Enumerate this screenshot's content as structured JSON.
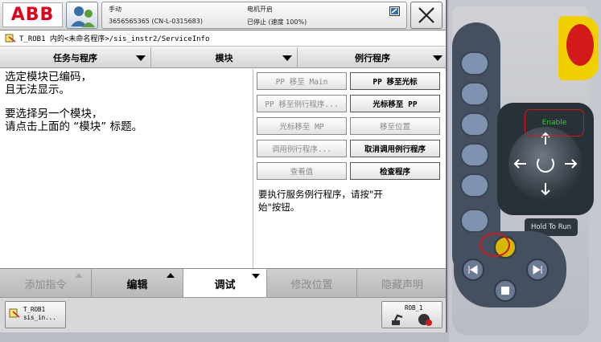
{
  "topbar": {
    "logo_text": "ABB",
    "mode": "手动",
    "controller_id": "3656565365 (CN-L-0315683)",
    "motor_state": "电机开启",
    "run_state": "已停止 (速度 100%)"
  },
  "path": "T_ROB1 内的<未命名程序>/sis_instr2/ServiceInfo",
  "tabs": [
    "任务与程序",
    "模块",
    "例行程序"
  ],
  "message": {
    "line1": "选定模块已编码，",
    "line2": "且无法显示。",
    "line3": "要选择另一个模块，",
    "line4": "请点击上面的 “模块” 标题。"
  },
  "buttons": {
    "pp_to_main": "PP 移至 Main",
    "pp_to_cursor": "PP 移至光标",
    "pp_to_routine": "PP 移至例行程序...",
    "cursor_to_pp": "光标移至 PP",
    "cursor_to_mp": "光标移至 MP",
    "goto_position": "移至位置",
    "call_routine": "调用例行程序...",
    "cancel_call": "取消调用例行程序",
    "view_value": "查看值",
    "check_program": "检查程序"
  },
  "hint": {
    "line1": "要执行服务例行程序，请按\"开",
    "line2": "始\"按钮。"
  },
  "bottom_tabs": [
    "添加指令",
    "编辑",
    "调试",
    "修改位置",
    "隐藏声明"
  ],
  "taskbar": {
    "task_line1": "T_ROB1",
    "task_line2": "sis_in...",
    "mode_label": "ROB_1"
  },
  "pendant": {
    "enable_label": "Enable",
    "hold_to_run_label": "Hold To Run"
  }
}
